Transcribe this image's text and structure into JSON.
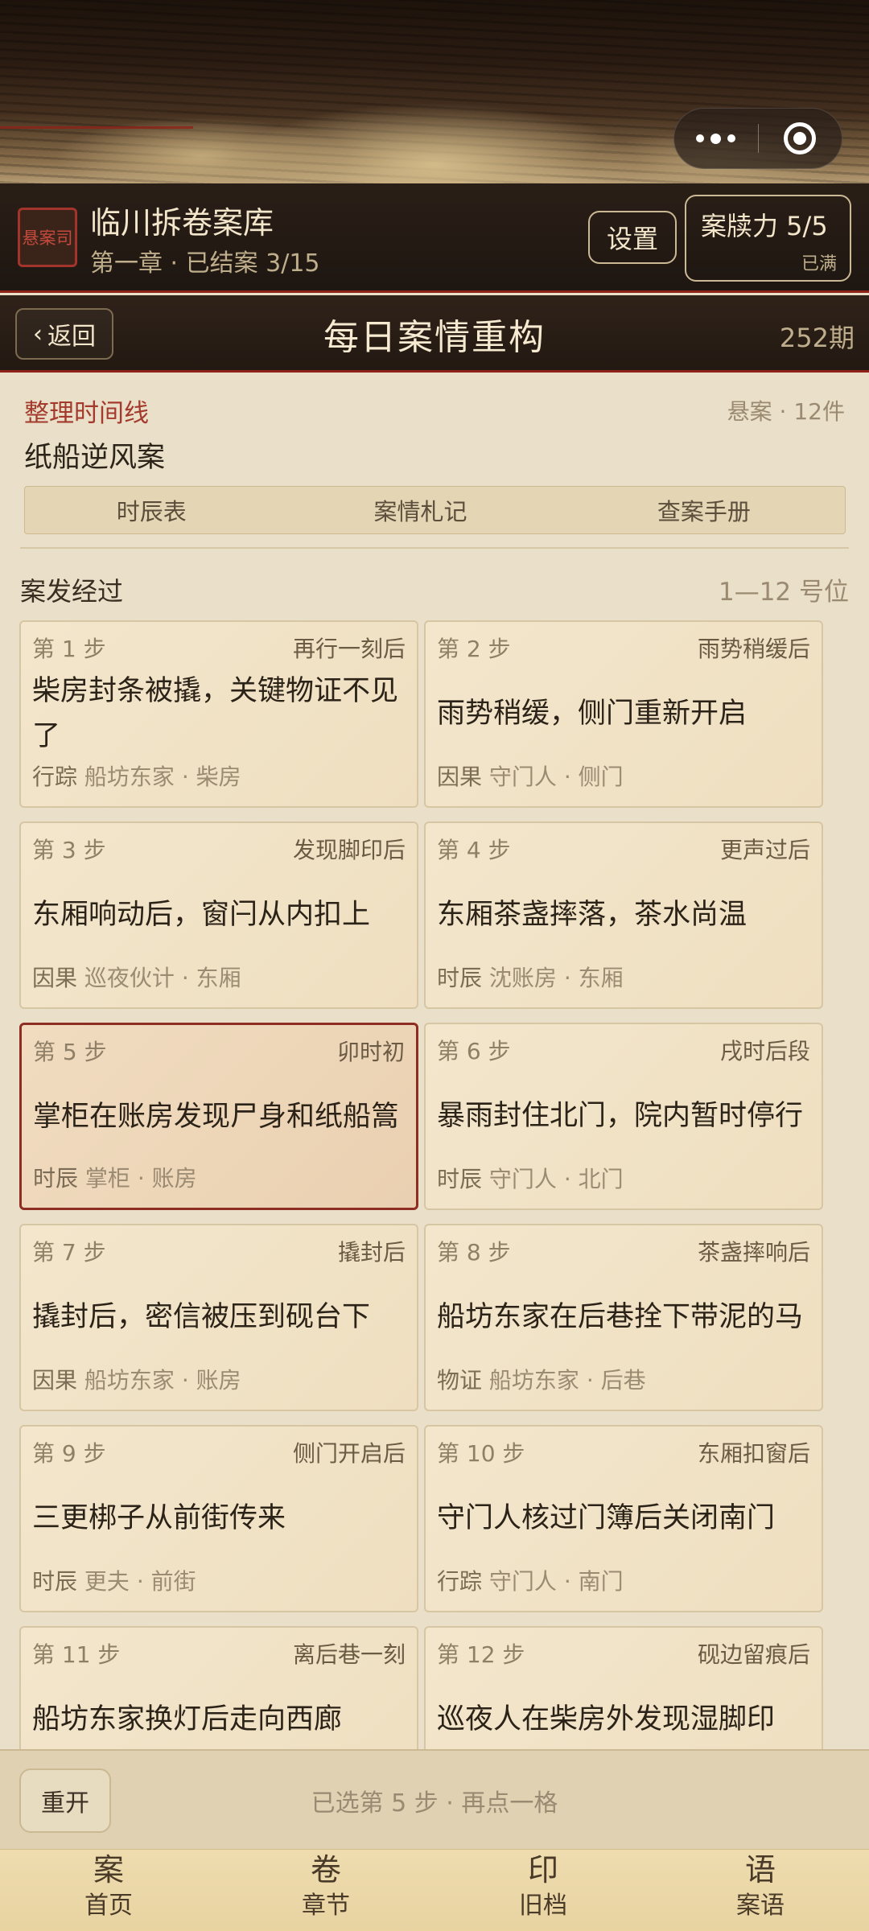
{
  "header": {
    "seal_text": "悬案司",
    "title": "临川拆卷案库",
    "subtitle": "第一章 · 已结案 3/15",
    "settings_label": "设置",
    "energy_label": "案牍力 5/5",
    "energy_status": "已满"
  },
  "nav": {
    "back_label": "返回",
    "title": "每日案情重构",
    "issue": "252期"
  },
  "case": {
    "kicker": "整理时间线",
    "meta": "悬案 · 12件",
    "name": "纸船逆风案",
    "tabs": [
      "时辰表",
      "案情札记",
      "查案手册"
    ]
  },
  "section": {
    "title": "案发经过",
    "range": "1—12 号位"
  },
  "steps": [
    {
      "num": "第 1 步",
      "time": "再行一刻后",
      "desc": "柴房封条被撬，关键物证不见了",
      "tag": "行踪",
      "who": "船坊东家",
      "place": "柴房"
    },
    {
      "num": "第 2 步",
      "time": "雨势稍缓后",
      "desc": "雨势稍缓，侧门重新开启",
      "tag": "因果",
      "who": "守门人",
      "place": "侧门"
    },
    {
      "num": "第 3 步",
      "time": "发现脚印后",
      "desc": "东厢响动后，窗闩从内扣上",
      "tag": "因果",
      "who": "巡夜伙计",
      "place": "东厢"
    },
    {
      "num": "第 4 步",
      "time": "更声过后",
      "desc": "东厢茶盏摔落，茶水尚温",
      "tag": "时辰",
      "who": "沈账房",
      "place": "东厢"
    },
    {
      "num": "第 5 步",
      "time": "卯时初",
      "desc": "掌柜在账房发现尸身和纸船篙",
      "tag": "时辰",
      "who": "掌柜",
      "place": "账房"
    },
    {
      "num": "第 6 步",
      "time": "戌时后段",
      "desc": "暴雨封住北门，院内暂时停行",
      "tag": "时辰",
      "who": "守门人",
      "place": "北门"
    },
    {
      "num": "第 7 步",
      "time": "撬封后",
      "desc": "撬封后，密信被压到砚台下",
      "tag": "因果",
      "who": "船坊东家",
      "place": "账房"
    },
    {
      "num": "第 8 步",
      "time": "茶盏摔响后",
      "desc": "船坊东家在后巷拴下带泥的马",
      "tag": "物证",
      "who": "船坊东家",
      "place": "后巷"
    },
    {
      "num": "第 9 步",
      "time": "侧门开启后",
      "desc": "三更梆子从前街传来",
      "tag": "时辰",
      "who": "更夫",
      "place": "前街"
    },
    {
      "num": "第 10 步",
      "time": "东厢扣窗后",
      "desc": "守门人核过门簿后关闭南门",
      "tag": "行踪",
      "who": "守门人",
      "place": "南门"
    },
    {
      "num": "第 11 步",
      "time": "离后巷一刻",
      "desc": "船坊东家换灯后走向西廊",
      "tag": "",
      "who": "",
      "place": ""
    },
    {
      "num": "第 12 步",
      "time": "砚边留痕后",
      "desc": "巡夜人在柴房外发现湿脚印",
      "tag": "",
      "who": "",
      "place": ""
    }
  ],
  "selected_step": 5,
  "actionbar": {
    "reset_label": "重开",
    "status": "已选第 5 步 · 再点一格"
  },
  "tabbar": [
    {
      "glyph": "案",
      "label": "首页"
    },
    {
      "glyph": "卷",
      "label": "章节"
    },
    {
      "glyph": "印",
      "label": "旧档"
    },
    {
      "glyph": "语",
      "label": "案语"
    }
  ],
  "icons": {
    "back": "chevron-left-icon",
    "more": "more-dots-icon",
    "close": "target-circle-icon"
  },
  "colors": {
    "accent_red": "#8e2218",
    "paper": "#eadfc8",
    "header_dark": "#231912"
  }
}
